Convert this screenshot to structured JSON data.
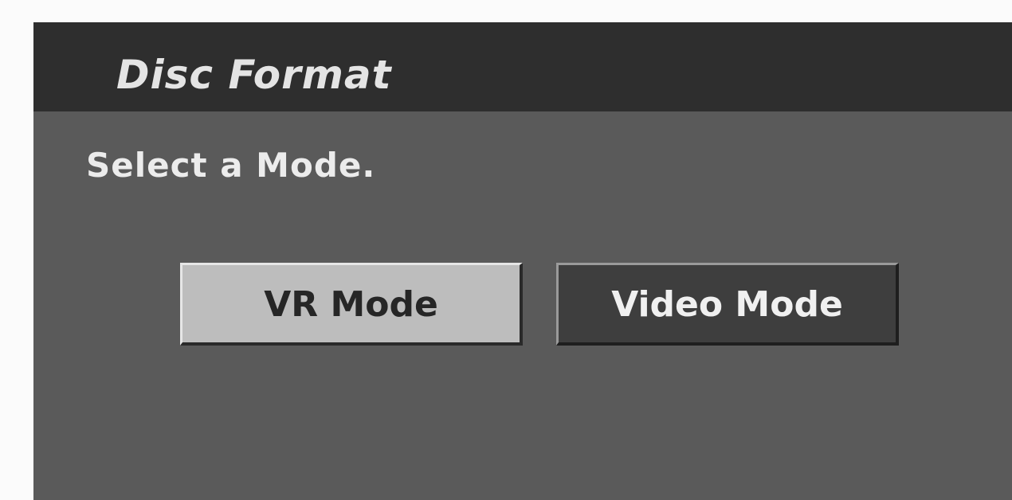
{
  "dialog": {
    "title": "Disc Format",
    "prompt": "Select a Mode.",
    "options": [
      {
        "label": "VR Mode",
        "selected": true
      },
      {
        "label": "Video Mode",
        "selected": false
      }
    ]
  },
  "colors": {
    "panel_background": "#5a5a5a",
    "title_bar": "#2e2e2e",
    "selected_button": "#bdbdbd",
    "unselected_button": "#3e3e3e",
    "text_light": "#ececec",
    "text_dark": "#262626"
  }
}
